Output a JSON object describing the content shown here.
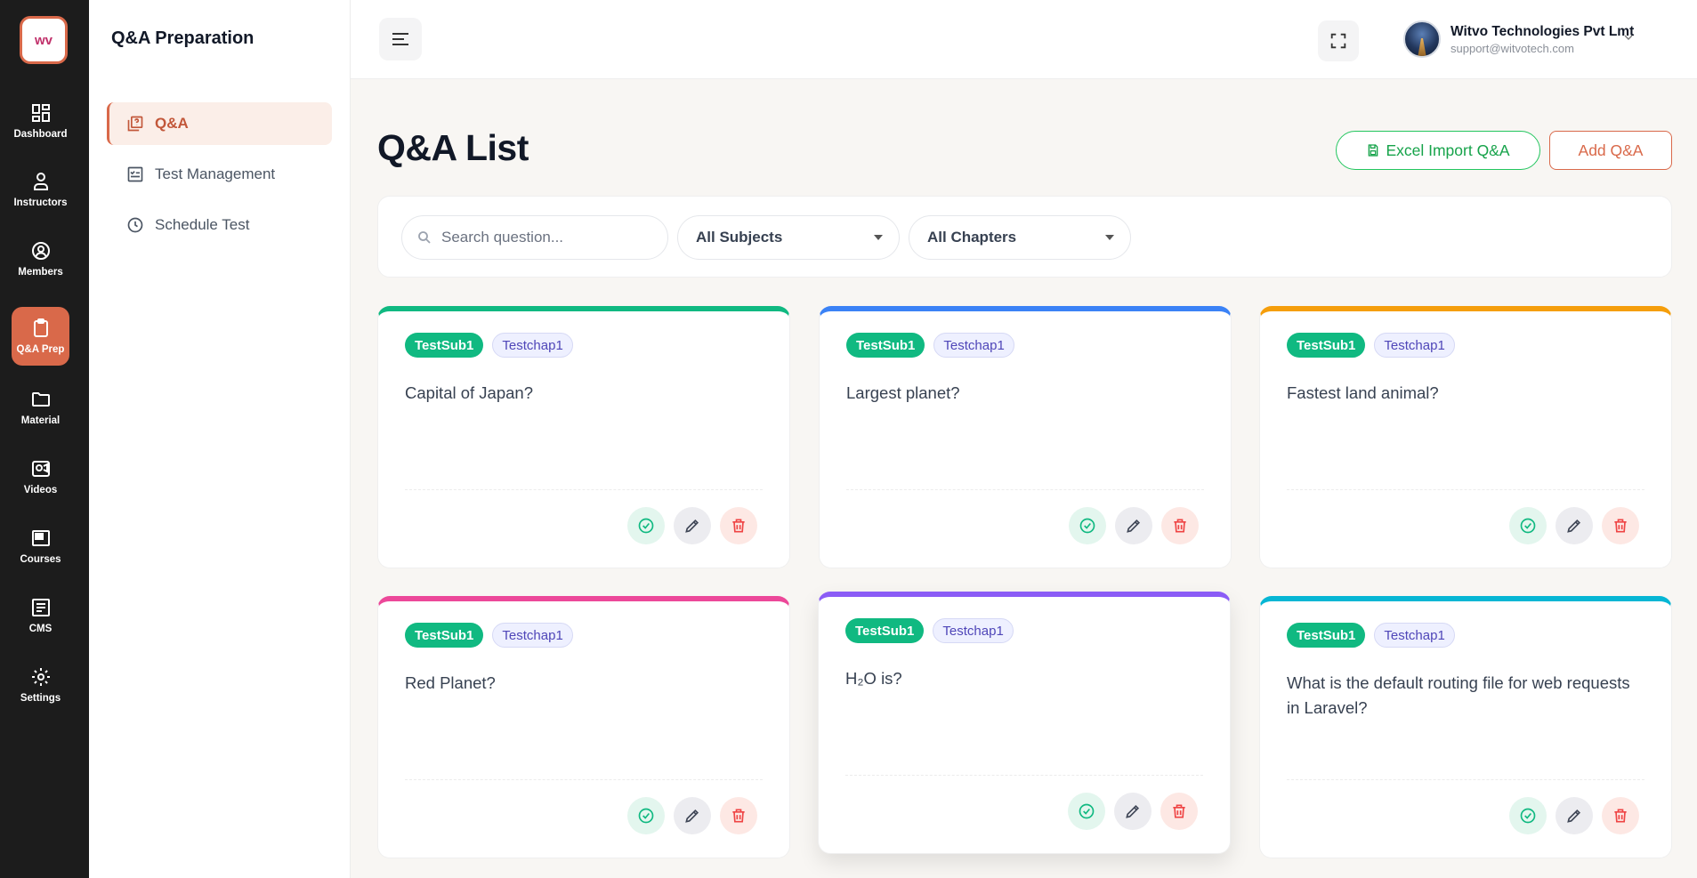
{
  "brand": {
    "logo_glyph": "ᴡᴠ",
    "accent": "#d9694a"
  },
  "rail": [
    {
      "label": "Dashboard",
      "icon": "dashboard-icon",
      "active": false
    },
    {
      "label": "Instructors",
      "icon": "instructor-icon",
      "active": false
    },
    {
      "label": "Members",
      "icon": "members-icon",
      "active": false
    },
    {
      "label": "Q&A Prep",
      "icon": "clipboard-icon",
      "active": true
    },
    {
      "label": "Material",
      "icon": "folder-icon",
      "active": false
    },
    {
      "label": "Videos",
      "icon": "video-icon",
      "active": false
    },
    {
      "label": "Courses",
      "icon": "courses-icon",
      "active": false
    },
    {
      "label": "CMS",
      "icon": "cms-icon",
      "active": false
    },
    {
      "label": "Settings",
      "icon": "gear-icon",
      "active": false
    }
  ],
  "subnav": {
    "title": "Q&A Preparation",
    "items": [
      {
        "label": "Q&A",
        "icon": "qa-icon",
        "active": true
      },
      {
        "label": "Test Management",
        "icon": "checklist-icon",
        "active": false
      },
      {
        "label": "Schedule Test",
        "icon": "clock-icon",
        "active": false
      }
    ]
  },
  "header": {
    "user_name": "Witvo Technologies Pvt Lmt",
    "user_email": "support@witvotech.com"
  },
  "main": {
    "title": "Q&A List",
    "excel_button": "Excel Import Q&A",
    "add_button": "Add Q&A",
    "search_placeholder": "Search question...",
    "subject_filter": "All Subjects",
    "chapter_filter": "All Chapters"
  },
  "cards": [
    {
      "subject": "TestSub1",
      "chapter": "Testchap1",
      "question": "Capital of Japan?",
      "accent": "#10b981"
    },
    {
      "subject": "TestSub1",
      "chapter": "Testchap1",
      "question": "Largest planet?",
      "accent": "#3b82f6"
    },
    {
      "subject": "TestSub1",
      "chapter": "Testchap1",
      "question": "Fastest land animal?",
      "accent": "#f59e0b"
    },
    {
      "subject": "TestSub1",
      "chapter": "Testchap1",
      "question": "Red Planet?",
      "accent": "#ec4899"
    },
    {
      "subject": "TestSub1",
      "chapter": "Testchap1",
      "question": "H₂O is?",
      "accent": "#8b5cf6"
    },
    {
      "subject": "TestSub1",
      "chapter": "Testchap1",
      "question": "What is the default routing file for web requests in Laravel?",
      "accent": "#06b6d4"
    }
  ]
}
